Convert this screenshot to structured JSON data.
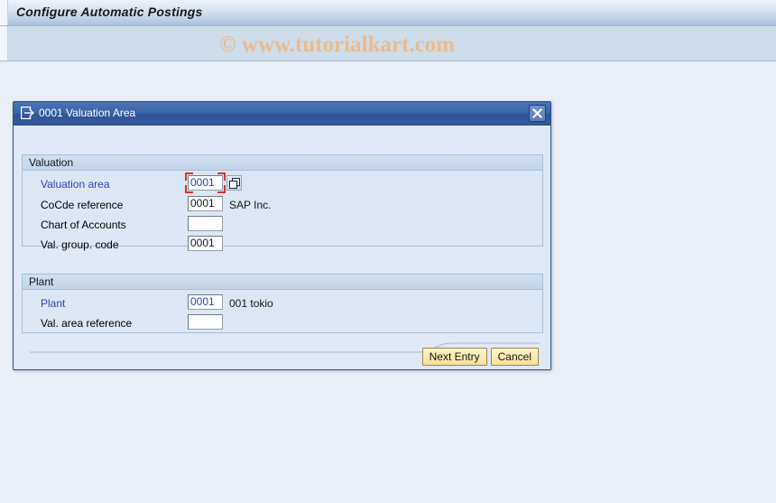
{
  "app": {
    "title": "Configure Automatic Postings",
    "watermark": "© www.tutorialkart.com"
  },
  "dialog": {
    "title": "0001 Valuation Area",
    "title_icon": "export-window-icon",
    "close_icon": "close-icon",
    "panels": [
      {
        "header": "Valuation",
        "rows": [
          {
            "label": "Valuation area",
            "label_key": true,
            "value": "0001",
            "value_key": true,
            "desc": "",
            "focused": true,
            "has_value_help": true
          },
          {
            "label": "CoCde reference",
            "label_key": false,
            "value": "0001",
            "value_key": false,
            "desc": "SAP Inc.",
            "focused": false,
            "has_value_help": false
          },
          {
            "label": "Chart of Accounts",
            "label_key": false,
            "value": "",
            "value_key": false,
            "desc": "",
            "focused": false,
            "has_value_help": false
          },
          {
            "label": "Val. group. code",
            "label_key": false,
            "value": "0001",
            "value_key": false,
            "desc": "",
            "focused": false,
            "has_value_help": false
          }
        ]
      },
      {
        "header": "Plant",
        "rows": [
          {
            "label": "Plant",
            "label_key": true,
            "value": "0001",
            "value_key": true,
            "desc": "001 tokio",
            "focused": false,
            "has_value_help": false
          },
          {
            "label": "Val. area reference",
            "label_key": false,
            "value": "",
            "value_key": false,
            "desc": "",
            "focused": false,
            "has_value_help": false
          }
        ]
      }
    ],
    "buttons": [
      {
        "label": "Next Entry",
        "name": "next-entry-button"
      },
      {
        "label": "Cancel",
        "name": "cancel-button"
      }
    ]
  },
  "colors": {
    "app_titlebar_accent": "#aac1da",
    "toolbar_band": "#cfdcea",
    "work_area": "#e9eef7",
    "dialog_titlebar": "#35589b",
    "panel_fill": "#dde7f3",
    "key_field_text": "#2a44bb",
    "focus_outline": "#d4342a",
    "button_face": "#fae9ae",
    "watermark_text": "#edbb8c"
  }
}
